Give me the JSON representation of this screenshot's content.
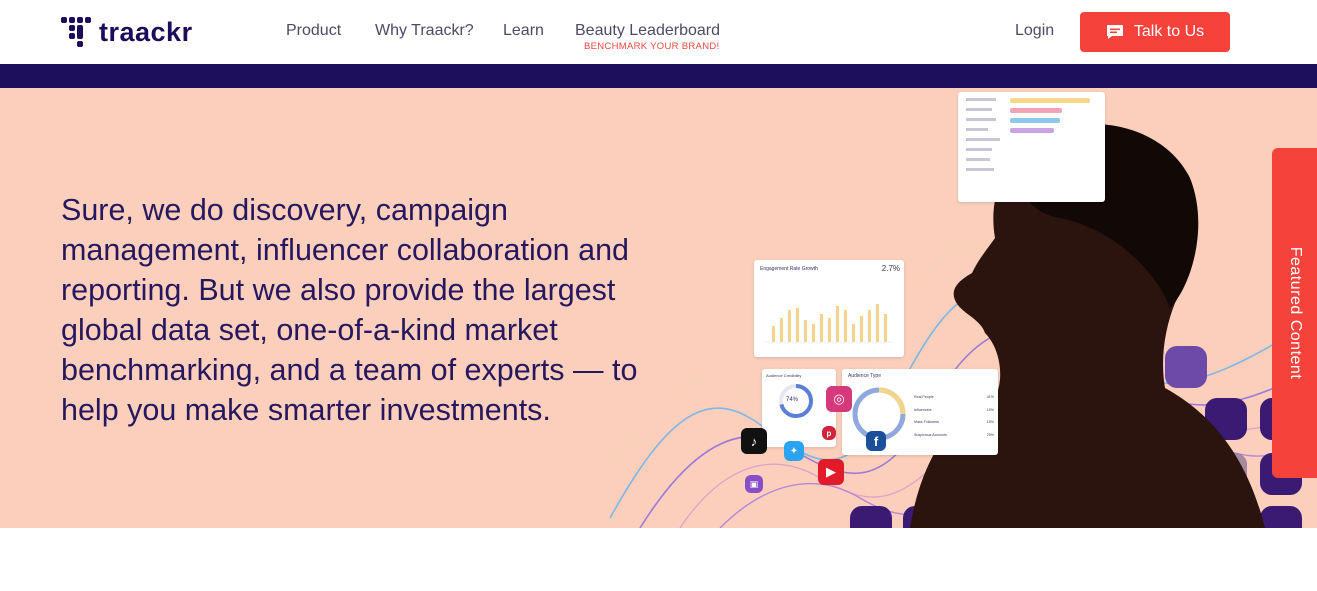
{
  "brand": {
    "name": "traackr",
    "color": "#1d0c5c"
  },
  "nav": {
    "items": [
      {
        "label": "Product"
      },
      {
        "label": "Why Traackr?"
      },
      {
        "label": "Learn"
      },
      {
        "label": "Beauty Leaderboard",
        "sublabel": "BENCHMARK YOUR BRAND!"
      }
    ],
    "login_label": "Login",
    "talk_label": "Talk to Us",
    "talk_icon": "chat-icon"
  },
  "hero": {
    "text": "Sure, we do discovery, campaign management, influencer collaboration and reporting. But we also provide the largest global data set, one-of-a-kind market benchmarking, and a team of experts — to help you make smarter investments."
  },
  "featured_tab": {
    "label": "Featured Content"
  },
  "illustration": {
    "engagement_card": {
      "title": "Engagement Rate Growth",
      "value": "2.7%"
    },
    "credibility_card": {
      "title": "Audience Credibility",
      "value": "74%"
    },
    "audience_type_card": {
      "title": "Audience Type",
      "rows": [
        {
          "label": "Real People",
          "value": "41%"
        },
        {
          "label": "Influencers",
          "value": "15%"
        },
        {
          "label": "Mass Followers",
          "value": "15%"
        },
        {
          "label": "Suspicious Accounts",
          "value": "29%"
        }
      ]
    },
    "social_icons": [
      "tiktok-icon",
      "instagram-icon",
      "twitter-icon",
      "pinterest-icon",
      "youtube-icon",
      "twitch-icon",
      "facebook-icon"
    ]
  },
  "colors": {
    "accent": "#f5433c",
    "navy": "#1e0f5c",
    "hero_bg": "#fccfbd",
    "hero_text": "#26185e"
  }
}
